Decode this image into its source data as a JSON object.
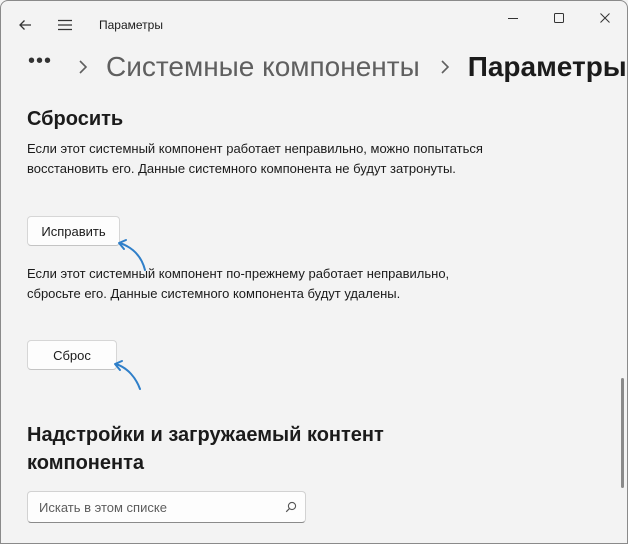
{
  "titlebar": {
    "app_title": "Параметры"
  },
  "breadcrumb": {
    "parent": "Системные компоненты",
    "current": "Параметры"
  },
  "reset_section": {
    "heading": "Сбросить",
    "repair_description": "Если этот системный компонент работает неправильно, можно попытаться восстановить его. Данные системного компонента не будут затронуты.",
    "repair_button": "Исправить",
    "reset_description": "Если этот системный компонент по-прежнему работает неправильно, сбросьте его. Данные системного компонента будут удалены.",
    "reset_button": "Сброс"
  },
  "addons_section": {
    "heading": "Надстройки и загружаемый контент компонента",
    "search_placeholder": "Искать в этом списке"
  },
  "icons": {
    "back": "back-arrow-icon",
    "menu": "hamburger-icon",
    "more": "more-icon",
    "chevron": "chevron-right-icon",
    "search": "search-icon",
    "annotation": "annotation-arrow-icon"
  },
  "colors": {
    "annotation_arrow": "#2f7fc9",
    "background": "#f3f3f3"
  }
}
